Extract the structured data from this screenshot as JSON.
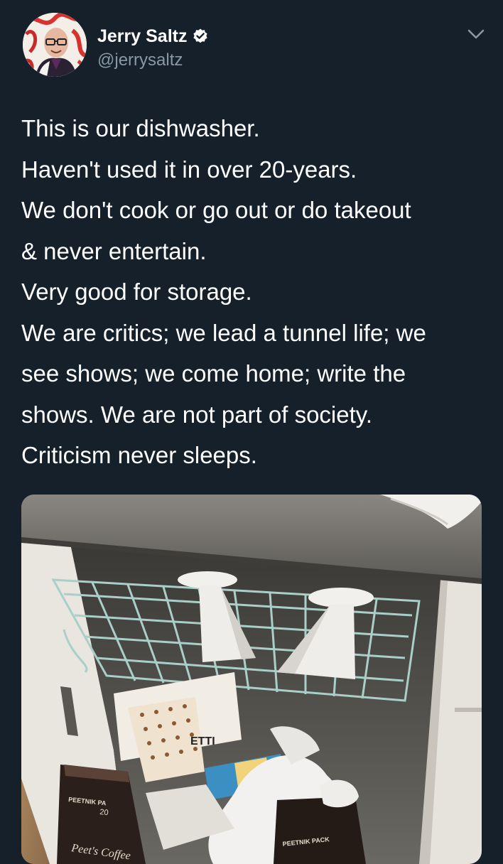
{
  "author": {
    "display_name": "Jerry Saltz",
    "handle": "@jerrysaltz",
    "verified": true,
    "avatar_icon": "profile-photo"
  },
  "actions": {
    "menu_icon": "chevron-down-icon"
  },
  "tweet": {
    "lines": [
      "This is our dishwasher.",
      "Haven't used it in over 20-years.",
      "We don't cook or go out or do takeout",
      "& never entertain.",
      "Very good for storage.",
      "We are critics; we lead a tunnel life; we",
      "see shows; we come home; write the",
      "shows. We are not part of society.",
      "Criticism never sleeps."
    ]
  },
  "photo": {
    "package_labels": {
      "peetnik_left": "PEETNIK PA",
      "peets_coffee": "Peet's Coffee",
      "peetnik_bottom": "PEETNIK PACK",
      "box_brand": "ETTI",
      "bag_number": "20"
    }
  },
  "colors": {
    "background": "#15202b",
    "text_primary": "#ffffff",
    "text_secondary": "#8899a6",
    "verified_badge": "#ffffff"
  }
}
